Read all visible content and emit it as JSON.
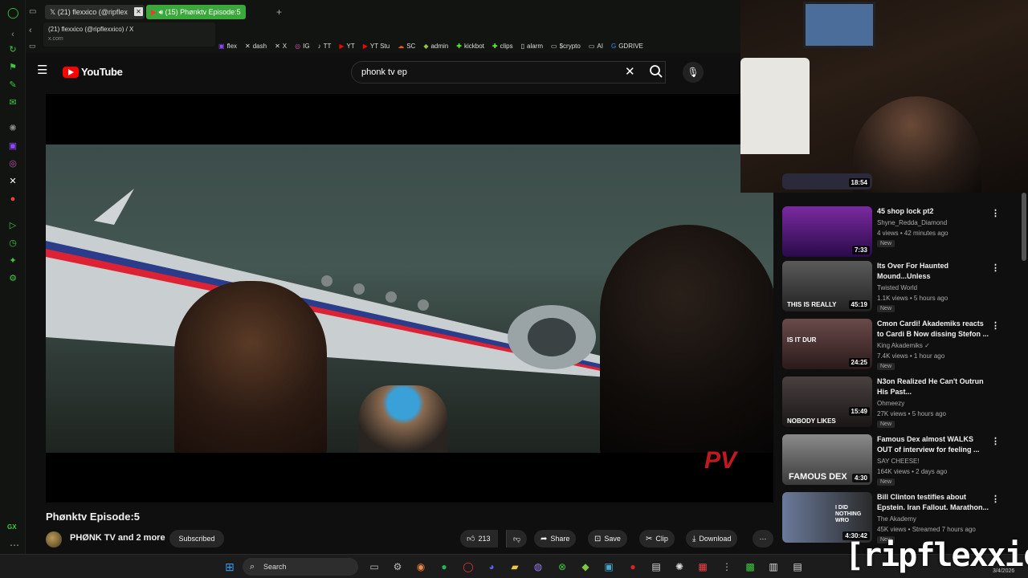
{
  "browser": {
    "tabs": [
      {
        "label": "(21) flexxico (@ripflex",
        "icon": "x-logo-icon"
      },
      {
        "label": "(15) Phønktv Episode:5",
        "icon": "youtube-icon"
      }
    ],
    "tooltip": {
      "title": "(21) flexxico (@ripflexxico) / X",
      "domain": "x.com"
    },
    "bookmarks": [
      {
        "label": "flex",
        "icon": "twitch-icon",
        "color": "#9146ff"
      },
      {
        "label": "dash",
        "icon": "x-logo-icon",
        "color": "#ffffff"
      },
      {
        "label": "X",
        "icon": "x-logo-icon",
        "color": "#ffffff"
      },
      {
        "label": "IG",
        "icon": "instagram-icon",
        "color": "#d74db0"
      },
      {
        "label": "TT",
        "icon": "tiktok-icon",
        "color": "#ffffff"
      },
      {
        "label": "YT",
        "icon": "youtube-icon",
        "color": "#ff0000"
      },
      {
        "label": "YT Stu",
        "icon": "youtube-icon",
        "color": "#ff0000"
      },
      {
        "label": "SC",
        "icon": "soundcloud-icon",
        "color": "#ff5500"
      },
      {
        "label": "admin",
        "icon": "shopify-icon",
        "color": "#95bf47"
      },
      {
        "label": "kickbot",
        "icon": "kick-icon",
        "color": "#53fc18"
      },
      {
        "label": "clips",
        "icon": "kick-icon",
        "color": "#53fc18"
      },
      {
        "label": "alarm",
        "icon": "doc-icon",
        "color": "#dddddd"
      },
      {
        "label": "$crypto",
        "icon": "folder-icon",
        "color": "#dddddd"
      },
      {
        "label": "AI",
        "icon": "folder-icon",
        "color": "#dddddd"
      },
      {
        "label": "GDRIVE",
        "icon": "google-icon",
        "color": "#4285f4"
      }
    ]
  },
  "youtube": {
    "logo_text": "YouTube",
    "search": {
      "value": "phonk tv ep"
    },
    "video": {
      "title": "Phønktv Episode:5",
      "channel": "PHØNK TV and 2 more",
      "subscribe_label": "Subscribed",
      "likes": "213",
      "share_label": "Share",
      "save_label": "Save",
      "clip_label": "Clip",
      "download_label": "Download"
    },
    "recommendations": [
      {
        "title": "",
        "channel": "",
        "meta": "",
        "badge": "",
        "duration": "18:54",
        "thumb": "#2a2a3a"
      },
      {
        "title": "45 shop lock pt2",
        "channel": "Shyne_Redda_Diamond",
        "meta": "4 views • 42 minutes ago",
        "badge": "New",
        "duration": "7:33",
        "thumb": "#6a1a8a"
      },
      {
        "title": "Its Over For Haunted Mound...Unless",
        "channel": "Twisted World",
        "meta": "1.1K views • 5 hours ago",
        "badge": "New",
        "duration": "45:19",
        "thumb": "#3a3a3a",
        "thumb_text": "THIS IS REALLY"
      },
      {
        "title": "Cmon Cardi! Akademiks reacts to Cardi B Now dissing Stefon ...",
        "channel": "King Akademiks",
        "meta": "7.4K views • 1 hour ago",
        "badge": "New",
        "duration": "24:25",
        "thumb": "#4a3a3a",
        "thumb_text": "IS IT DUR"
      },
      {
        "title": "N3on Realized He Can't Outrun His Past...",
        "channel": "Ohmeezy",
        "meta": "27K views • 5 hours ago",
        "badge": "New",
        "duration": "15:49",
        "thumb": "#2a2a2a",
        "thumb_text": "NOBODY LIKES"
      },
      {
        "title": "Famous Dex almost WALKS OUT of interview for feeling ...",
        "channel": "SAY CHEESE!",
        "meta": "164K views • 2 days ago",
        "badge": "New",
        "duration": "4:30",
        "thumb": "#5a5a5a",
        "thumb_text": "FAMOUS DEX"
      },
      {
        "title": "Bill Clinton testifies about Epstein. Iran Fallout. Marathon...",
        "channel": "The Akademy",
        "meta": "45K views • Streamed 7 hours ago",
        "badge": "New",
        "duration": "4:30:42",
        "thumb": "#3a4a6a",
        "thumb_text": "I DID NOTHING WRO"
      }
    ]
  },
  "taskbar": {
    "search_label": "Search",
    "clock": "3/4/2026"
  },
  "overlay": {
    "handle": "[ripflexxico]"
  }
}
